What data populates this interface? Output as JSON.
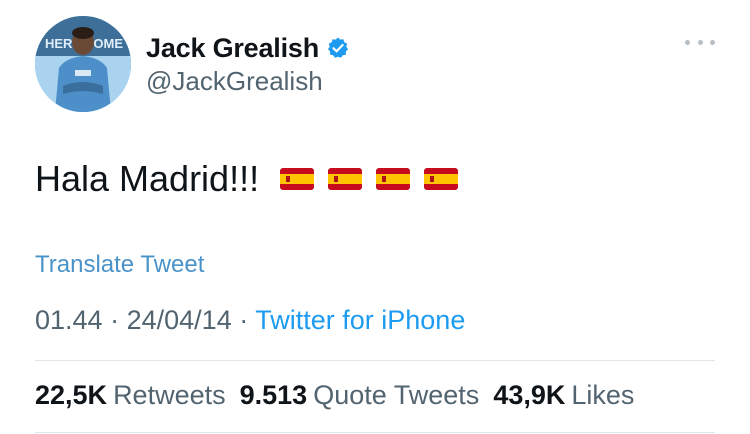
{
  "profile": {
    "display_name": "Jack Grealish",
    "handle": "@JackGrealish",
    "verified": true,
    "verified_color": "#1d9bf0",
    "avatar_background_text": "HERE SOME"
  },
  "tweet": {
    "text": "Hala Madrid!!!",
    "emoji": [
      "spain-flag",
      "spain-flag",
      "spain-flag",
      "spain-flag"
    ],
    "translate_label": "Translate Tweet",
    "time": "01.44",
    "date": "24/04/14",
    "separator": "·",
    "source": "Twitter for iPhone"
  },
  "stats": {
    "retweets_count": "22,5K",
    "retweets_label": "Retweets",
    "quotes_count": "9.513",
    "quotes_label": "Quote Tweets",
    "likes_count": "43,9K",
    "likes_label": "Likes"
  },
  "colors": {
    "text_primary": "#0f1419",
    "text_secondary": "#536471",
    "link": "#1d9bf0",
    "flag_red": "#c60b1e",
    "flag_yellow": "#ffc400"
  }
}
